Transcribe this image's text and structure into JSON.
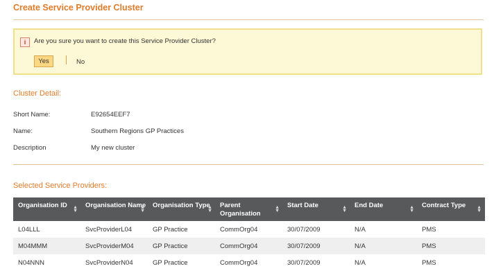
{
  "page": {
    "title": "Create Service Provider Cluster"
  },
  "confirm": {
    "message": "Are you sure you want to create this Service Provider Cluster?",
    "yes_label": "Yes",
    "no_label": "No"
  },
  "cluster_detail": {
    "heading": "Cluster Detail:",
    "fields": [
      {
        "label": "Short Name:",
        "value": "E92654EEF7"
      },
      {
        "label": "Name:",
        "value": "Southern Regions GP Practices"
      },
      {
        "label": "Description",
        "value": "My new cluster"
      }
    ]
  },
  "providers": {
    "heading": "Selected Service Providers:",
    "columns": [
      "Organisation ID",
      "Organisation Name",
      "Organisation Type",
      "Parent Organisation",
      "Start Date",
      "End Date",
      "Contract Type"
    ],
    "rows": [
      [
        "L04LLL",
        "SvcProviderL04",
        "GP Practice",
        "CommOrg04",
        "30/07/2009",
        "N/A",
        "PMS"
      ],
      [
        "M04MMM",
        "SvcProviderM04",
        "GP Practice",
        "CommOrg04",
        "30/07/2009",
        "N/A",
        "PMS"
      ],
      [
        "N04NNN",
        "SvcProviderN04",
        "GP Practice",
        "CommOrg04",
        "30/07/2009",
        "N/A",
        "PMS"
      ]
    ]
  },
  "colors": {
    "accent": "#e07b2a",
    "grid_header": "#58595b",
    "confirm_bg": "#fdf9d6"
  },
  "icons": {
    "warning": "warning-icon",
    "sort": "sort-icon"
  }
}
